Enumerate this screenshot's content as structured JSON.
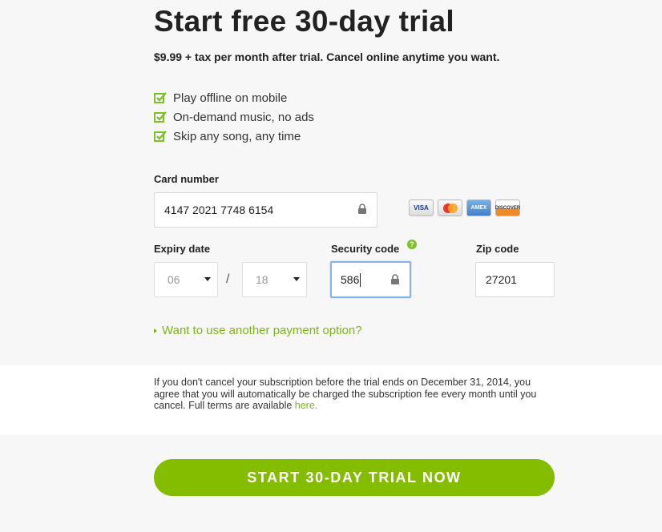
{
  "header": {
    "title": "Start free 30-day trial",
    "price": "$9.99",
    "price_suffix": " + tax per month after trial. Cancel online anytime you want."
  },
  "features": [
    "Play offline on mobile",
    "On-demand music, no ads",
    "Skip any song, any time"
  ],
  "card": {
    "label": "Card number",
    "value": "4147 2021 7748 6154",
    "logos": [
      "VISA",
      "MasterCard",
      "AMEX",
      "DISCOVER"
    ]
  },
  "expiry": {
    "label": "Expiry date",
    "month": "06",
    "year": "18",
    "separator": "/"
  },
  "security": {
    "label": "Security code",
    "value": "586",
    "help": "?"
  },
  "zip": {
    "label": "Zip code",
    "value": "27201"
  },
  "payment_link": "Want to use another payment option?",
  "terms": {
    "text": "If you don't cancel your subscription before the trial ends on December 31, 2014, you agree that you will automatically be charged the subscription fee every month until you cancel. Full terms are available ",
    "link": "here."
  },
  "cta": "START 30-DAY TRIAL NOW",
  "colors": {
    "accent": "#84bd00",
    "link": "#7cb518",
    "focus_border": "#8bb0e6"
  },
  "icons": [
    "check-icon",
    "lock-icon",
    "help-icon",
    "chevron-down-icon"
  ]
}
